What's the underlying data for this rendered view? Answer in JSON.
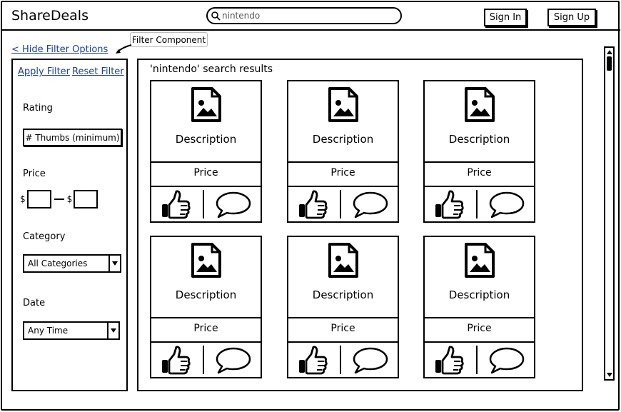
{
  "header": {
    "brand": "ShareDeals",
    "search": {
      "value": "nintendo"
    },
    "sign_in": "Sign In",
    "sign_up": "Sign Up"
  },
  "annotation": {
    "callout": "Filter Component"
  },
  "filters": {
    "hide_link": "< Hide Filter Options",
    "apply": "Apply Filter",
    "reset": "Reset Filter",
    "rating_label": "Rating",
    "thumbs_placeholder": "# Thumbs (minimum)",
    "price_label": "Price",
    "currency": "$",
    "category_label": "Category",
    "category_value": "All Categories",
    "date_label": "Date",
    "date_value": "Any Time"
  },
  "results": {
    "title": "'nintendo' search results",
    "cards": [
      {
        "description": "Description",
        "price": "Price"
      },
      {
        "description": "Description",
        "price": "Price"
      },
      {
        "description": "Description",
        "price": "Price"
      },
      {
        "description": "Description",
        "price": "Price"
      },
      {
        "description": "Description",
        "price": "Price"
      },
      {
        "description": "Description",
        "price": "Price"
      }
    ]
  },
  "icons": {
    "search": "search-icon",
    "image": "image-placeholder-icon",
    "like": "thumbs-up-icon",
    "comment": "speech-bubble-icon",
    "dropdown": "chevron-down-icon"
  }
}
